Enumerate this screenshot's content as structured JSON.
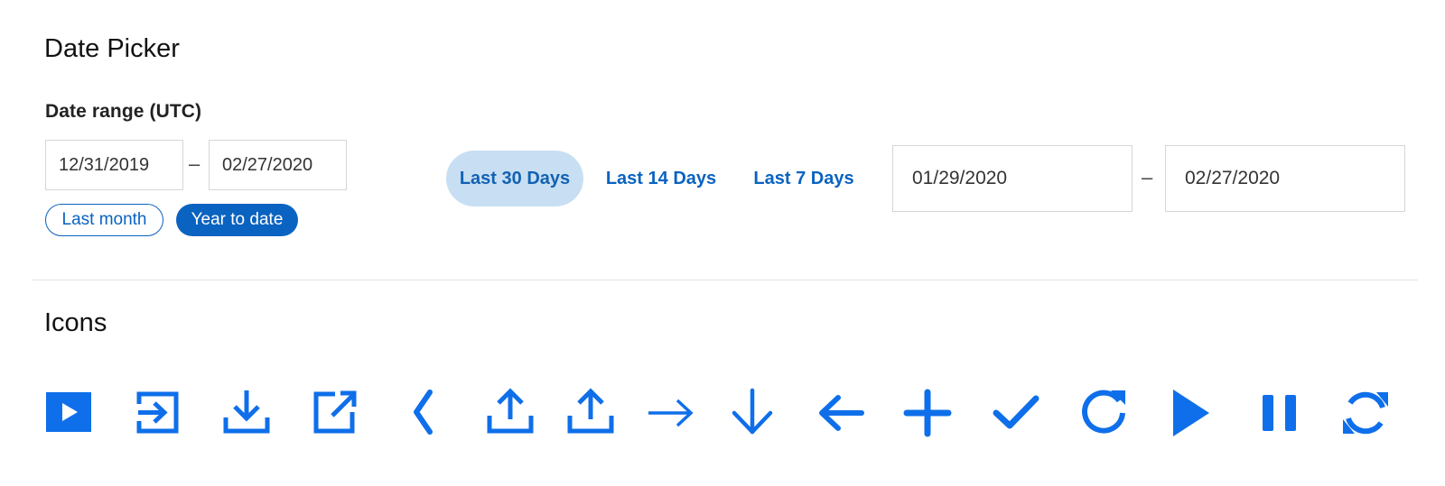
{
  "sections": {
    "date_picker_title": "Date Picker",
    "icons_title": "Icons"
  },
  "date_range": {
    "label": "Date range (UTC)",
    "start": "12/31/2019",
    "end": "02/27/2020",
    "separator": "–",
    "presets": {
      "last_month": "Last month",
      "year_to_date": "Year to date"
    }
  },
  "quick_range": {
    "options": [
      "Last 30 Days",
      "Last 14 Days",
      "Last 7 Days"
    ],
    "selected": "Last 30 Days",
    "start": "01/29/2020",
    "end": "02/27/2020",
    "separator": "–"
  },
  "colors": {
    "accent": "#0a63c0",
    "icon_blue": "#0f6fea",
    "selected_bg": "#c8dff3",
    "border": "#d6d6d6"
  },
  "icons": [
    "play-box-icon",
    "sign-in-icon",
    "download-icon",
    "external-link-icon",
    "chevron-left-icon",
    "upload-icon",
    "upload-alt-icon",
    "arrow-right-icon",
    "arrow-down-icon",
    "arrow-left-icon",
    "plus-icon",
    "check-icon",
    "redo-icon",
    "play-icon",
    "pause-icon",
    "refresh-icon"
  ]
}
